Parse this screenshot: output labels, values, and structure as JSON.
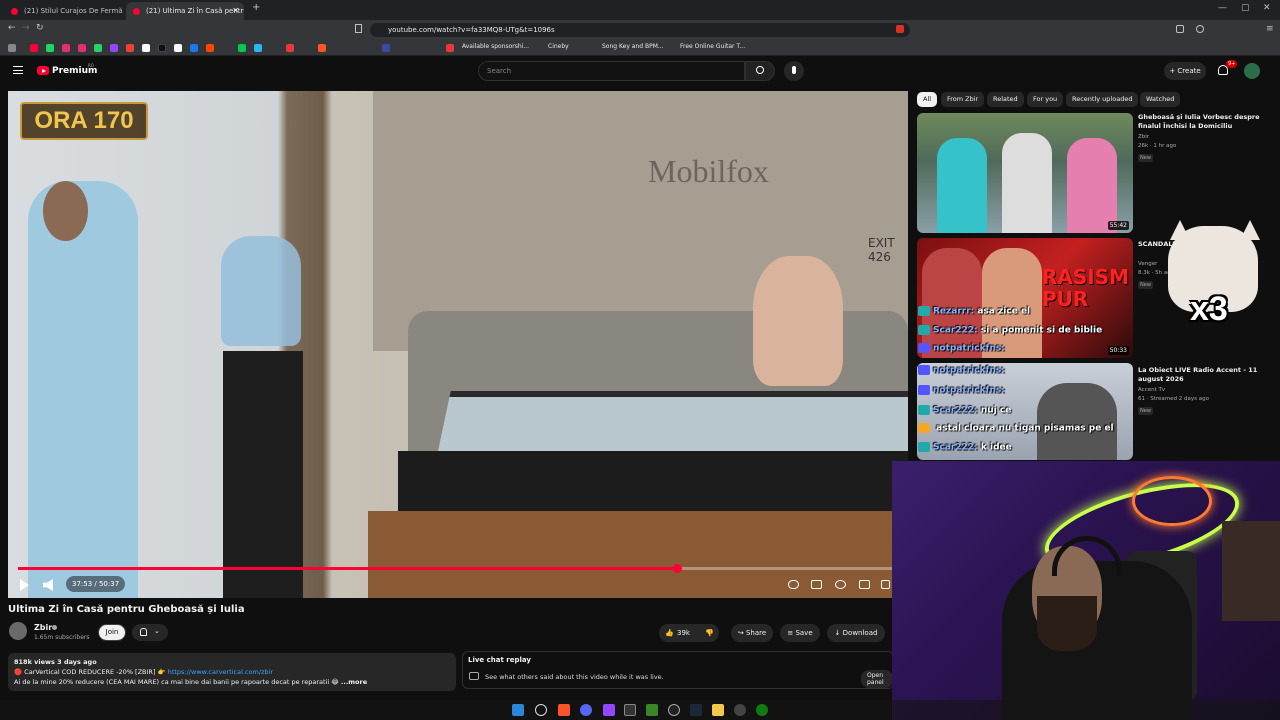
{
  "browser": {
    "tabs": [
      {
        "label": "(21) Stilul Curajos De Fermă Al Mamei",
        "active": false
      },
      {
        "label": "(21) Ultima Zi în Casă pentru Gh",
        "active": true
      }
    ],
    "url": "youtube.com/watch?v=fa33MQ8-UTg&t=1096s",
    "bookmarks": [
      "Available sponsorshi...",
      "Cineby",
      "Song Key and BPM...",
      "Free Online Guitar T..."
    ]
  },
  "youtube": {
    "brand": "Premium",
    "brand_sup": "RO",
    "search_placeholder": "Search",
    "create_label": "+ Create",
    "notif_count": "9+"
  },
  "video": {
    "badge_text": "ORA 170",
    "wall_text": "Mobilfox",
    "exit_text": "EXIT 426",
    "time": "37:53 / 50:37",
    "progress": 0.7484,
    "title": "Ultima Zi în Casă pentru Gheboasă și Iulia"
  },
  "channel": {
    "name": "Zbir",
    "subs": "1.65m subscribers",
    "join_label": "Join"
  },
  "actions": {
    "likes": "39k",
    "share": "Share",
    "save": "Save",
    "download": "Download"
  },
  "description": {
    "meta": "818k views  3 days ago",
    "line1_prefix": "🔴 CarVertical COD REDUCERE -20% [ZBIR] 👉 ",
    "line1_link": "https://www.carvertical.com/zbir",
    "line2": "Ai de la mine 20% reducere (CEA MAI MARE) ca mai bine dai banii pe rapoarte decat pe reparatii 😂",
    "more": "...more"
  },
  "live_chat": {
    "title": "Live chat replay",
    "subtitle": "See what others said about this video while it was live.",
    "open": "Open panel"
  },
  "chips": [
    "All",
    "From Zbir",
    "Related",
    "For you",
    "Recently uploaded",
    "Watched"
  ],
  "recommendations": [
    {
      "title": "Gheboasă și Iulia Vorbesc despre finalul Închisi la Domiciliu",
      "channel": "Zbir",
      "meta": "26k · 1 hr ago",
      "badge": "New",
      "duration": "55:42"
    },
    {
      "title": "SCANDALUL... A AJUNS P...",
      "channel": "Venger",
      "meta": "8.3k · 5h ago",
      "badge": "New",
      "duration": "50:33",
      "thumb_text": "RASISM PUR"
    },
    {
      "title": "La Obiect LIVE Radio Accent - 11 august 2026",
      "channel": "Accent Tv",
      "meta": "61 · Streamed 2 days ago",
      "badge": "New",
      "duration": ""
    }
  ],
  "chat_overlay": [
    {
      "user": "Rezarrr:",
      "text": "asa zice el"
    },
    {
      "user": "Scar222:",
      "text": "si a pomenit si de biblie"
    },
    {
      "user": "notpatrickfns:",
      "text": ""
    },
    {
      "user": "notpatrickfns:",
      "text": ""
    },
    {
      "user": "notpatrickfns:",
      "text": ""
    },
    {
      "user": "Scar222:",
      "text": "nuj ce"
    },
    {
      "user": "",
      "text": "astal cloara nu tigan pisamas pe el"
    },
    {
      "user": "Scar222:",
      "text": "k idee"
    }
  ],
  "cat_overlay": {
    "text": "x3"
  },
  "colors": {
    "accent": "#ff0033",
    "bg": "#0f0f0f",
    "neon": "#c8ff4a"
  }
}
